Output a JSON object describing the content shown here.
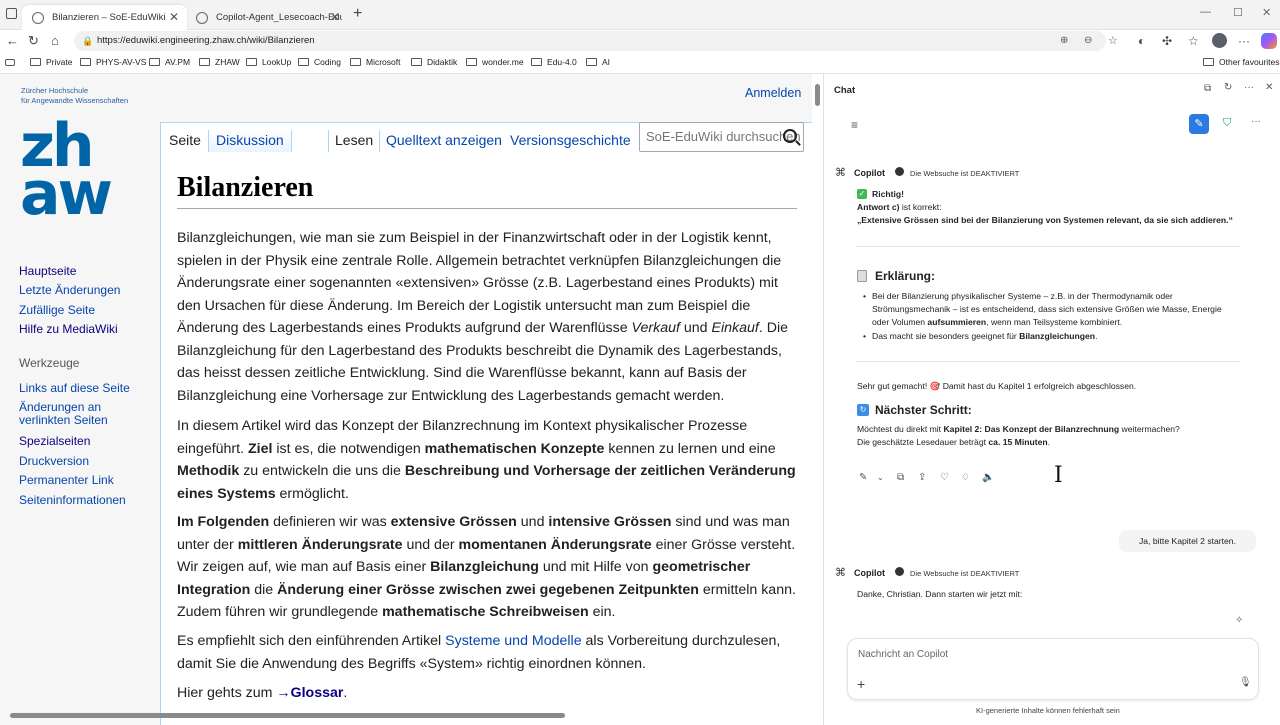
{
  "browser": {
    "tabs": [
      {
        "title": "Bilanzieren – SoE-EduWiki",
        "active": true
      },
      {
        "title": "Copilot-Agent_Lesecoach-EduWi",
        "active": false
      }
    ],
    "new_tab": "+",
    "url": "https://eduwiki.engineering.zhaw.ch/wiki/Bilanzieren",
    "bookmarks": [
      "Private",
      "PHYS-AV-VS",
      "AV.PM",
      "ZHAW",
      "LookUp",
      "Coding",
      "Microsoft",
      "Didaktik",
      "wonder.me",
      "Edu-4.0",
      "AI"
    ],
    "other_favourites": "Other favourites"
  },
  "wiki": {
    "logo_line1": "Zürcher Hochschule",
    "logo_line2": "für Angewandte Wissenschaften",
    "logo_text": "zh aw",
    "login": "Anmelden",
    "tabs": {
      "page": "Seite",
      "discussion": "Diskussion",
      "read": "Lesen",
      "source": "Quelltext anzeigen",
      "history": "Versionsgeschichte"
    },
    "search_placeholder": "SoE-EduWiki durchsuchen",
    "nav": [
      "Hauptseite",
      "Letzte Änderungen",
      "Zufällige Seite",
      "Hilfe zu MediaWiki"
    ],
    "tools_heading": "Werkzeuge",
    "tools": [
      "Links auf diese Seite",
      "Änderungen an verlinkten Seiten",
      "Spezialseiten",
      "Druckversion",
      "Permanenter Link",
      "Seiteninformationen"
    ],
    "title": "Bilanzieren",
    "p1": {
      "a": "Bilanzgleichungen, wie man sie zum Beispiel in der Finanzwirtschaft oder in der Logistik kennt, spielen in der Physik eine zentrale Rolle. Allgemein betrachtet verknüpfen Bilanzgleichungen die Änderungsrate einer sogenannten «extensiven» Grösse (z.B. Lagerbestand eines Produkts) mit den Ursachen für diese Änderung. Im Bereich der Logistik untersucht man zum Beispiel die Änderung des Lagerbestands eines Produkts aufgrund der Warenflüsse ",
      "i1": "Verkauf",
      "b": " und ",
      "i2": "Einkauf",
      "c": ". Die Bilanzgleichung für den Lagerbestand des Produkts beschreibt die Dynamik des Lagerbestands, das heisst dessen zeitliche Entwicklung. Sind die Warenflüsse bekannt, kann auf Basis der Bilanzgleichung eine Vorhersage zur Entwicklung des Lagerbestands gemacht werden."
    },
    "p2": {
      "a": "In diesem Artikel wird das Konzept der Bilanzrechnung im Kontext physikalischer Prozesse eingeführt. ",
      "b1": "Ziel",
      "b": " ist es, die notwendigen ",
      "b2": "mathematischen Konzepte",
      "c": " kennen zu lernen und eine ",
      "b3": "Methodik",
      "d": " zu entwickeln die uns die ",
      "b4": "Beschreibung und Vorhersage der zeitlichen Veränderung eines Systems",
      "e": " ermöglicht."
    },
    "p3": {
      "b1": "Im Folgenden",
      "a": " definieren wir was ",
      "b2": "extensive Grössen",
      "b": " und ",
      "b3": "intensive Grössen",
      "c": " sind und was man unter der ",
      "b4": "mittleren Änderungsrate",
      "d": " und der ",
      "b5": "momentanen Änderungsrate",
      "e": " einer Grösse versteht. Wir zeigen auf, wie man auf Basis einer ",
      "b6": "Bilanzgleichung",
      "f": " und mit Hilfe von ",
      "b7": "geometrischer Integration",
      "g": " die ",
      "b8": "Änderung einer Grösse zwischen zwei gegebenen Zeitpunkten",
      "h": " ermitteln kann. Zudem führen wir grundlegende ",
      "b9": "mathematische Schreibweisen",
      "i": " ein."
    },
    "p4": {
      "a": "Es empfiehlt sich den einführenden Artikel ",
      "link": "Systeme und Modelle",
      "b": " als Vorbereitung durchzulesen, damit Sie die Anwendung des Begriffs «System» richtig einordnen können."
    },
    "p5": {
      "a": "Hier gehts zum ",
      "link": "→Glossar",
      "b": "."
    }
  },
  "chat": {
    "title": "Chat",
    "msg1": {
      "sender": "Copilot",
      "info": "Die Websuche ist DEAKTIVIERT",
      "correct": "Richtig!",
      "answer_label": "Antwort c)",
      "answer_suffix": " ist korrekt:",
      "answer_quote": "„Extensive Grössen sind bei der Bilanzierung von Systemen relevant, da sie sich addieren.“",
      "explain_heading": "Erklärung:",
      "bullet1_a": "Bei der Bilanzierung physikalischer Systeme – z.B. in der Thermodynamik oder",
      "bullet1_b": "Strömungsmechanik – ist es entscheidend, dass sich extensive Größen wie Masse, Energie",
      "bullet1_c": "oder Volumen ",
      "bullet1_bold": "aufsummieren",
      "bullet1_d": ", wenn man Teilsysteme kombiniert.",
      "bullet2_a": "Das macht sie besonders geeignet für ",
      "bullet2_bold": "Bilanzgleichungen",
      "bullet2_b": ".",
      "praise": "Sehr gut gemacht! 🎯 Damit hast du Kapitel 1 erfolgreich abgeschlossen.",
      "next_heading": "Nächster Schritt:",
      "next_a": "Möchtest du direkt mit ",
      "next_bold": "Kapitel 2: Das Konzept der Bilanzrechnung",
      "next_b": " weitermachen?",
      "dur_a": "Die geschätzte Lesedauer beträgt ",
      "dur_bold": "ca. 15 Minuten",
      "dur_b": "."
    },
    "user_msg": "Ja, bitte Kapitel 2 starten.",
    "msg2": {
      "sender": "Copilot",
      "info": "Die Websuche ist DEAKTIVIERT",
      "text": "Danke, Christian. Dann starten wir jetzt mit:"
    },
    "composer_placeholder": "Nachricht an Copilot",
    "disclaimer": "KI-generierte Inhalte können fehlerhaft sein"
  }
}
